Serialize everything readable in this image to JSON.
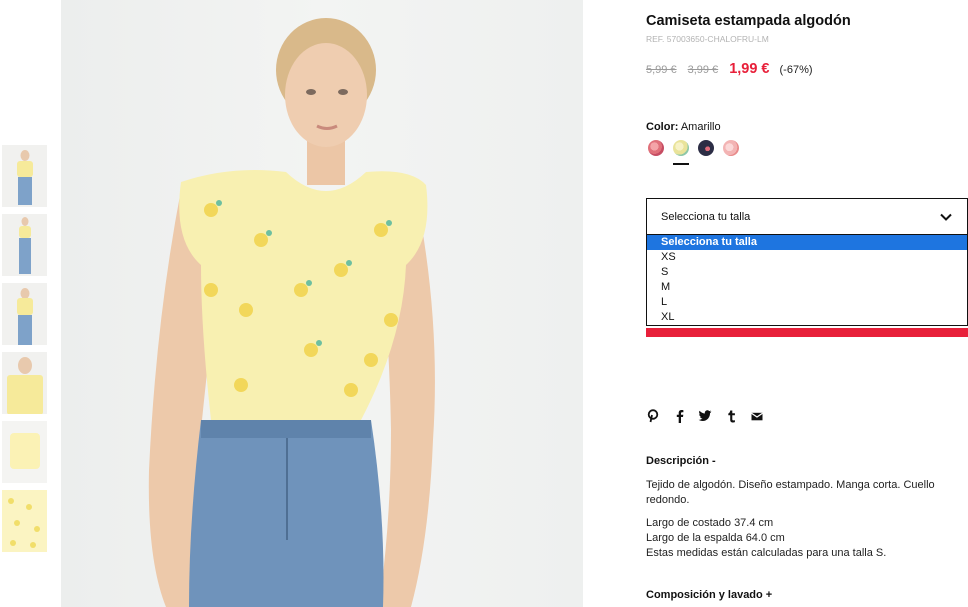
{
  "product": {
    "title": "Camiseta estampada algodón",
    "ref": "REF. 57003650-CHALOFRU-LM",
    "price_original": "5,99 €",
    "price_previous": "3,99 €",
    "price_sale": "1,99 €",
    "discount": "(-67%)"
  },
  "color": {
    "label": "Color:",
    "value": "Amarillo",
    "swatches": [
      {
        "name": "floral-red",
        "color": "#e0707a"
      },
      {
        "name": "amarillo",
        "color": "#e9e39a"
      },
      {
        "name": "navy",
        "color": "#2c2d45"
      },
      {
        "name": "pink",
        "color": "#f3b4b4"
      }
    ]
  },
  "size": {
    "placeholder": "Selecciona tu talla",
    "options": [
      "Selecciona tu talla",
      "XS",
      "S",
      "M",
      "L",
      "XL"
    ]
  },
  "share": {
    "icons": [
      "pinterest-icon",
      "facebook-icon",
      "twitter-icon",
      "tumblr-icon",
      "email-icon"
    ]
  },
  "description": {
    "title": "Descripción -",
    "text1": "Tejido de algodón. Diseño estampado. Manga corta. Cuello redondo.",
    "line1": "Largo de costado 37.4 cm",
    "line2": "Largo de la espalda 64.0 cm",
    "line3": "Estas medidas están calculadas para una talla S."
  },
  "composition": {
    "title": "Composición y lavado +"
  },
  "colors": {
    "accent_red": "#e8203a",
    "select_blue": "#1e75e0"
  }
}
